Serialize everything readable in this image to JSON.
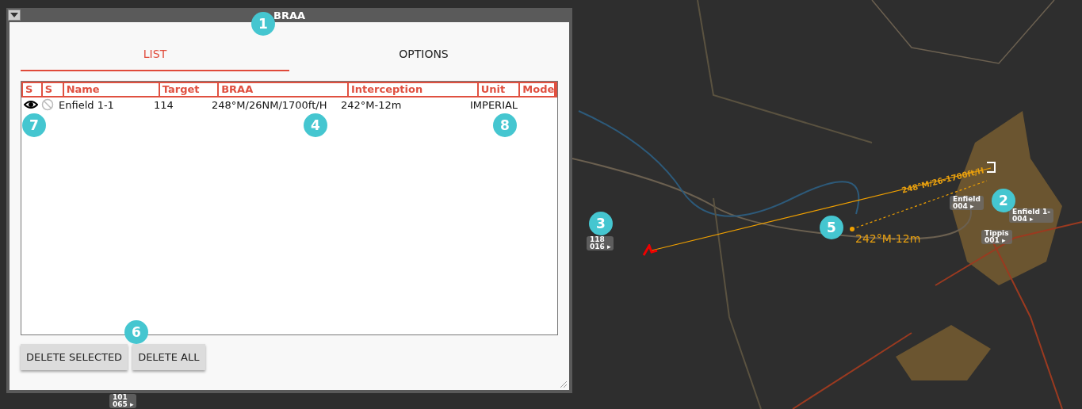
{
  "window": {
    "title": "BRAA"
  },
  "tabs": [
    {
      "label": "LIST",
      "selected": true
    },
    {
      "label": "OPTIONS",
      "selected": false
    }
  ],
  "table": {
    "columns": [
      "S",
      "S",
      "Name",
      "Target",
      "BRAA",
      "Interception",
      "Unit",
      "Mode"
    ],
    "rows": [
      {
        "visible": true,
        "tracked": false,
        "name": "Enfield 1-1",
        "target": "114",
        "braa": "248°M/26NM/1700ft/H",
        "interception": "242°M-12m",
        "unit": "IMPERIAL"
      }
    ]
  },
  "buttons": [
    "DELETE SELECTED",
    "DELETE ALL"
  ],
  "map": {
    "units": [
      {
        "lines": [
          "Enfield",
          "004 ▸"
        ]
      },
      {
        "lines": [
          "Enfield 1-",
          "004 ▸"
        ]
      },
      {
        "lines": [
          "Tippis",
          "001 ▸"
        ]
      },
      {
        "lines": [
          "118",
          "016 ▸"
        ]
      },
      {
        "lines": [
          "101",
          "065 ▸"
        ]
      }
    ],
    "braa_label": "248°M/26-1700ft/H",
    "intercept_label": "242°M-12m"
  },
  "callouts": [
    {
      "label": "1"
    },
    {
      "label": "2"
    },
    {
      "label": "3"
    },
    {
      "label": "4"
    },
    {
      "label": "5"
    },
    {
      "label": "6"
    },
    {
      "label": "7"
    },
    {
      "label": "8"
    }
  ]
}
